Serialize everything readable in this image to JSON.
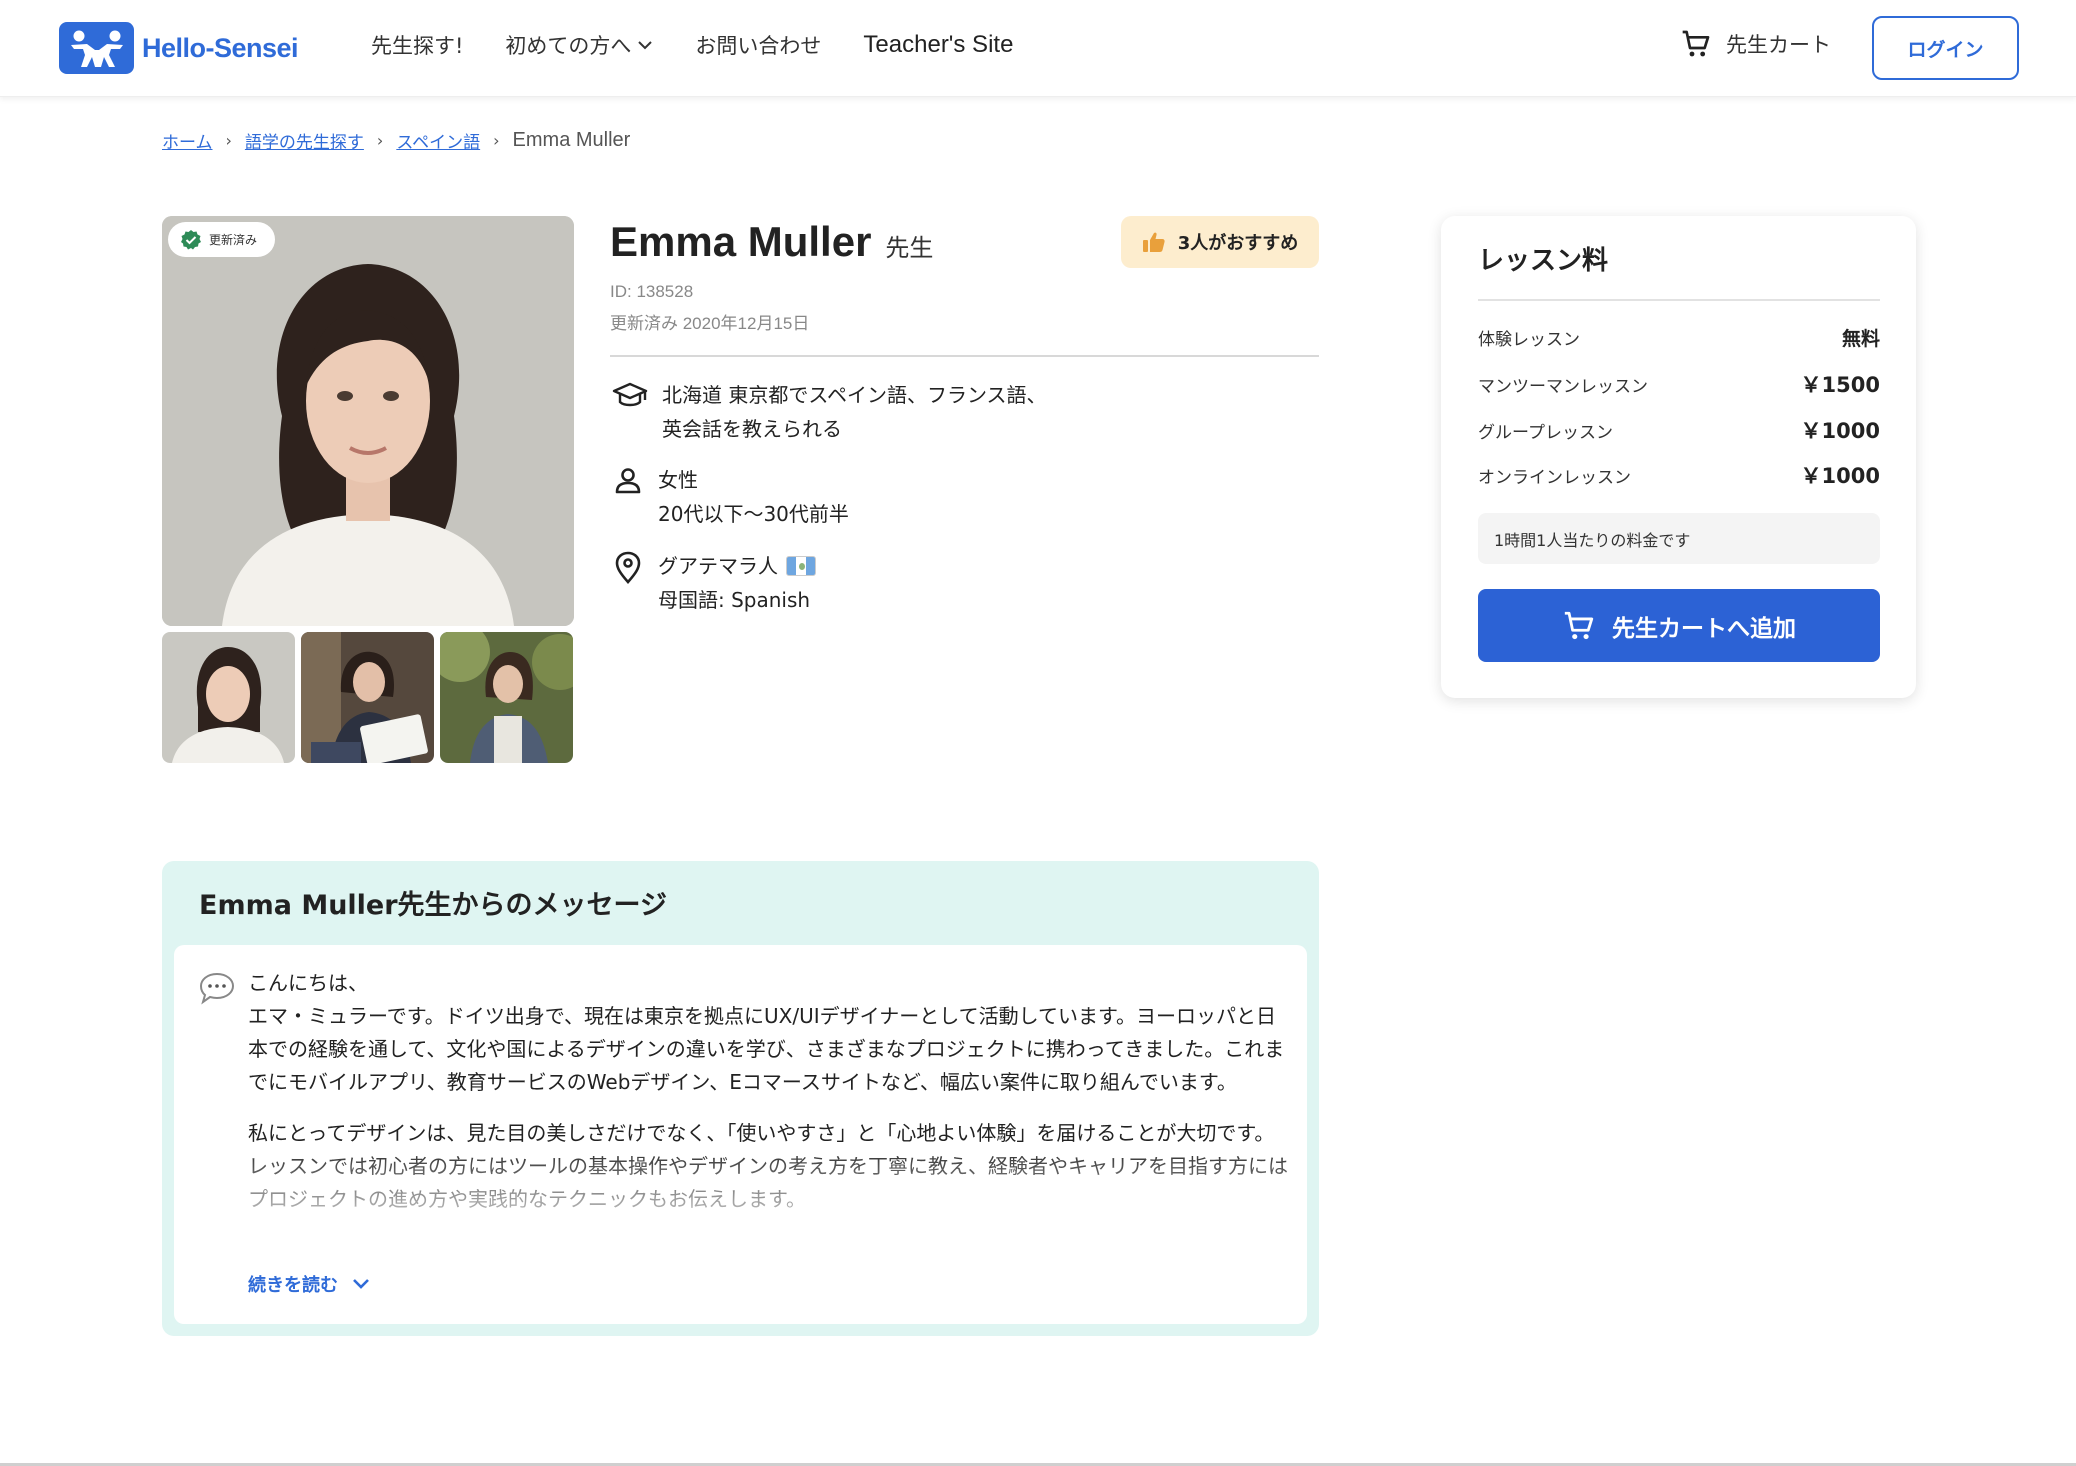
{
  "header": {
    "logo_text": "Hello-Sensei",
    "nav": [
      {
        "label": "先生探す!"
      },
      {
        "label": "初めての方へ"
      },
      {
        "label": "お問い合わせ"
      },
      {
        "label": "Teacher's Site"
      }
    ],
    "cart_label": "先生カート",
    "login_label": "ログイン"
  },
  "breadcrumb": {
    "items": [
      "ホーム",
      "語学の先生探す",
      "スペイン語"
    ],
    "current": "Emma Muller"
  },
  "profile": {
    "verified_label": "更新済み",
    "name": "Emma Muller",
    "suffix": "先生",
    "recommend": "3人がおすすめ",
    "id_text": "ID: 138528",
    "updated_text": "更新済み 2020年12月15日",
    "teaching_line1": "北海道 東京都でスペイン語、フランス語、",
    "teaching_line2": "英会話を教えられる",
    "gender": "女性",
    "age": "20代以下〜30代前半",
    "nationality": "グアテマラ人",
    "native_language": "母国語: Spanish"
  },
  "pricing": {
    "title": "レッスン料",
    "rows": [
      {
        "label": "体験レッスン",
        "value": "無料"
      },
      {
        "label": "マンツーマンレッスン",
        "value": "￥1500"
      },
      {
        "label": "グループレッスン",
        "value": "￥1000"
      },
      {
        "label": "オンラインレッスン",
        "value": "￥1000"
      }
    ],
    "note": "1時間1人当たりの料金です",
    "add_button": "先生カートへ追加"
  },
  "message": {
    "title": "Emma Muller先生からのメッセージ",
    "para1": "こんにちは、\nエマ・ミュラーです。ドイツ出身で、現在は東京を拠点にUX/UIデザイナーとして活動しています。ヨーロッパと日本での経験を通して、文化や国によるデザインの違いを学び、さまざまなプロジェクトに携わってきました。これまでにモバイルアプリ、教育サービスのWebデザイン、Eコマースサイトなど、幅広い案件に取り組んでいます。",
    "para2": "私にとってデザインは、見た目の美しさだけでなく、「使いやすさ」と「心地よい体験」を届けることが大切です。レッスンでは初心者の方にはツールの基本操作やデザインの考え方を丁寧に教え、経験者やキャリアを目指す方にはプロジェクトの進め方や実践的なテクニックもお伝えします。",
    "read_more": "続きを読む"
  },
  "colors": {
    "brand": "#2f6bd8",
    "button": "#2c62d5",
    "message_bg": "#dff5f2",
    "recommend_bg": "#fdedce",
    "verified_green": "#2e8b57"
  }
}
